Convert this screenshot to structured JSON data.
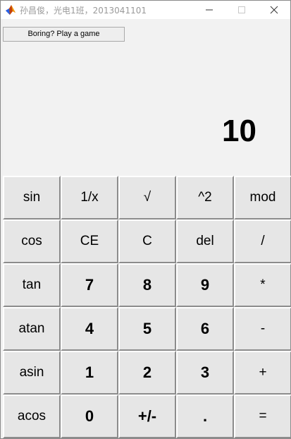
{
  "window": {
    "title": "孙昌俊，光电1班，2013041101"
  },
  "toolbar": {
    "game_button_label": "Boring? Play a game"
  },
  "display": {
    "value": "10"
  },
  "keypad": {
    "rows": [
      [
        "sin",
        "1/x",
        "√",
        "^2",
        "mod"
      ],
      [
        "cos",
        "CE",
        "C",
        "del",
        "/"
      ],
      [
        "tan",
        "7",
        "8",
        "9",
        "*"
      ],
      [
        "atan",
        "4",
        "5",
        "6",
        "-"
      ],
      [
        "asin",
        "1",
        "2",
        "3",
        "+"
      ],
      [
        "acos",
        "0",
        "+/-",
        ".",
        "="
      ]
    ]
  },
  "icons": {
    "app": "matlab-logo-icon",
    "minimize": "minimize-icon",
    "maximize": "maximize-icon",
    "close": "close-icon"
  }
}
